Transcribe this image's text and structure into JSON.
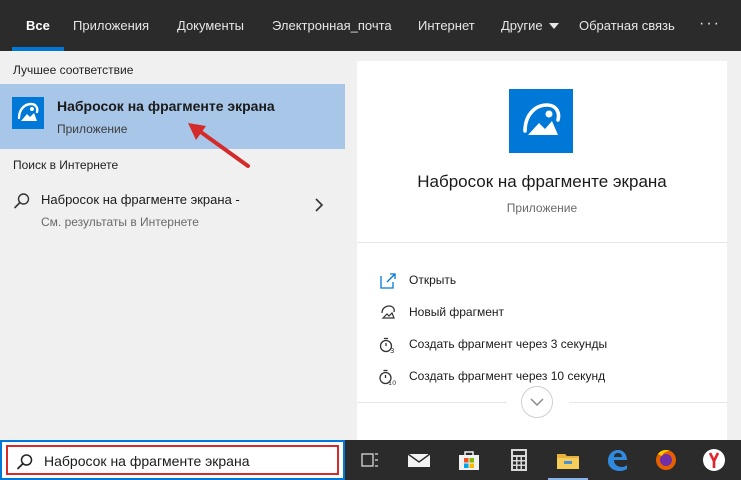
{
  "tabs": [
    {
      "label": "Все",
      "active": true
    },
    {
      "label": "Приложения"
    },
    {
      "label": "Документы"
    },
    {
      "label": "Электронная_почта"
    },
    {
      "label": "Интернет"
    },
    {
      "label": "Другие"
    },
    {
      "label": "Обратная связь"
    }
  ],
  "more_label": "···",
  "left": {
    "best_match_heading": "Лучшее соответствие",
    "best_match": {
      "title": "Набросок на фрагменте экрана",
      "subtitle": "Приложение",
      "icon": "snip-sketch-icon"
    },
    "web_heading": "Поиск в Интернете",
    "web_result": {
      "title": "Набросок на фрагменте экрана -",
      "subtitle": "См. результаты в Интернете"
    }
  },
  "detail": {
    "title": "Набросок на фрагменте экрана",
    "subtitle": "Приложение",
    "actions": [
      {
        "label": "Открыть",
        "icon": "open-icon"
      },
      {
        "label": "Новый фрагмент",
        "icon": "new-snip-icon"
      },
      {
        "label": "Создать фрагмент через 3 секунды",
        "icon": "timer-3-icon"
      },
      {
        "label": "Создать фрагмент через 10 секунд",
        "icon": "timer-10-icon"
      }
    ]
  },
  "taskbar": {
    "search_value": "Набросок на фрагменте экрана",
    "icons": [
      "task-view-icon",
      "mail-icon",
      "store-icon",
      "calculator-icon",
      "file-explorer-icon",
      "edge-icon",
      "firefox-icon",
      "yandex-icon"
    ]
  },
  "colors": {
    "accent": "#0078d7",
    "selection": "#a7c6e8",
    "annotation": "#d42a2a",
    "bar": "#2b2b2b"
  }
}
